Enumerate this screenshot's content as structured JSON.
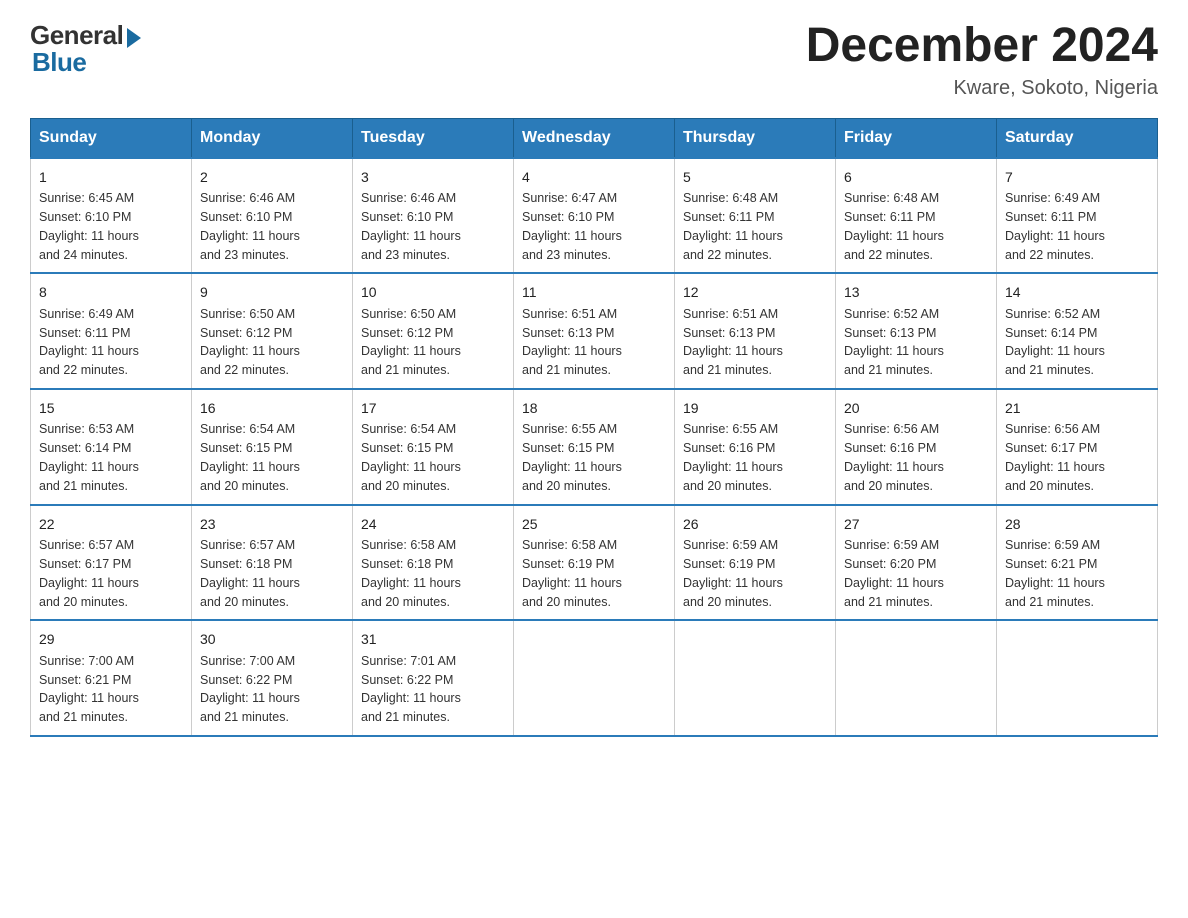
{
  "logo": {
    "general": "General",
    "blue": "Blue"
  },
  "title": "December 2024",
  "subtitle": "Kware, Sokoto, Nigeria",
  "days_header": [
    "Sunday",
    "Monday",
    "Tuesday",
    "Wednesday",
    "Thursday",
    "Friday",
    "Saturday"
  ],
  "weeks": [
    [
      {
        "num": "1",
        "sunrise": "6:45 AM",
        "sunset": "6:10 PM",
        "daylight": "11 hours and 24 minutes."
      },
      {
        "num": "2",
        "sunrise": "6:46 AM",
        "sunset": "6:10 PM",
        "daylight": "11 hours and 23 minutes."
      },
      {
        "num": "3",
        "sunrise": "6:46 AM",
        "sunset": "6:10 PM",
        "daylight": "11 hours and 23 minutes."
      },
      {
        "num": "4",
        "sunrise": "6:47 AM",
        "sunset": "6:10 PM",
        "daylight": "11 hours and 23 minutes."
      },
      {
        "num": "5",
        "sunrise": "6:48 AM",
        "sunset": "6:11 PM",
        "daylight": "11 hours and 22 minutes."
      },
      {
        "num": "6",
        "sunrise": "6:48 AM",
        "sunset": "6:11 PM",
        "daylight": "11 hours and 22 minutes."
      },
      {
        "num": "7",
        "sunrise": "6:49 AM",
        "sunset": "6:11 PM",
        "daylight": "11 hours and 22 minutes."
      }
    ],
    [
      {
        "num": "8",
        "sunrise": "6:49 AM",
        "sunset": "6:11 PM",
        "daylight": "11 hours and 22 minutes."
      },
      {
        "num": "9",
        "sunrise": "6:50 AM",
        "sunset": "6:12 PM",
        "daylight": "11 hours and 22 minutes."
      },
      {
        "num": "10",
        "sunrise": "6:50 AM",
        "sunset": "6:12 PM",
        "daylight": "11 hours and 21 minutes."
      },
      {
        "num": "11",
        "sunrise": "6:51 AM",
        "sunset": "6:13 PM",
        "daylight": "11 hours and 21 minutes."
      },
      {
        "num": "12",
        "sunrise": "6:51 AM",
        "sunset": "6:13 PM",
        "daylight": "11 hours and 21 minutes."
      },
      {
        "num": "13",
        "sunrise": "6:52 AM",
        "sunset": "6:13 PM",
        "daylight": "11 hours and 21 minutes."
      },
      {
        "num": "14",
        "sunrise": "6:52 AM",
        "sunset": "6:14 PM",
        "daylight": "11 hours and 21 minutes."
      }
    ],
    [
      {
        "num": "15",
        "sunrise": "6:53 AM",
        "sunset": "6:14 PM",
        "daylight": "11 hours and 21 minutes."
      },
      {
        "num": "16",
        "sunrise": "6:54 AM",
        "sunset": "6:15 PM",
        "daylight": "11 hours and 20 minutes."
      },
      {
        "num": "17",
        "sunrise": "6:54 AM",
        "sunset": "6:15 PM",
        "daylight": "11 hours and 20 minutes."
      },
      {
        "num": "18",
        "sunrise": "6:55 AM",
        "sunset": "6:15 PM",
        "daylight": "11 hours and 20 minutes."
      },
      {
        "num": "19",
        "sunrise": "6:55 AM",
        "sunset": "6:16 PM",
        "daylight": "11 hours and 20 minutes."
      },
      {
        "num": "20",
        "sunrise": "6:56 AM",
        "sunset": "6:16 PM",
        "daylight": "11 hours and 20 minutes."
      },
      {
        "num": "21",
        "sunrise": "6:56 AM",
        "sunset": "6:17 PM",
        "daylight": "11 hours and 20 minutes."
      }
    ],
    [
      {
        "num": "22",
        "sunrise": "6:57 AM",
        "sunset": "6:17 PM",
        "daylight": "11 hours and 20 minutes."
      },
      {
        "num": "23",
        "sunrise": "6:57 AM",
        "sunset": "6:18 PM",
        "daylight": "11 hours and 20 minutes."
      },
      {
        "num": "24",
        "sunrise": "6:58 AM",
        "sunset": "6:18 PM",
        "daylight": "11 hours and 20 minutes."
      },
      {
        "num": "25",
        "sunrise": "6:58 AM",
        "sunset": "6:19 PM",
        "daylight": "11 hours and 20 minutes."
      },
      {
        "num": "26",
        "sunrise": "6:59 AM",
        "sunset": "6:19 PM",
        "daylight": "11 hours and 20 minutes."
      },
      {
        "num": "27",
        "sunrise": "6:59 AM",
        "sunset": "6:20 PM",
        "daylight": "11 hours and 21 minutes."
      },
      {
        "num": "28",
        "sunrise": "6:59 AM",
        "sunset": "6:21 PM",
        "daylight": "11 hours and 21 minutes."
      }
    ],
    [
      {
        "num": "29",
        "sunrise": "7:00 AM",
        "sunset": "6:21 PM",
        "daylight": "11 hours and 21 minutes."
      },
      {
        "num": "30",
        "sunrise": "7:00 AM",
        "sunset": "6:22 PM",
        "daylight": "11 hours and 21 minutes."
      },
      {
        "num": "31",
        "sunrise": "7:01 AM",
        "sunset": "6:22 PM",
        "daylight": "11 hours and 21 minutes."
      },
      null,
      null,
      null,
      null
    ]
  ],
  "labels": {
    "sunrise": "Sunrise:",
    "sunset": "Sunset:",
    "daylight": "Daylight:"
  }
}
